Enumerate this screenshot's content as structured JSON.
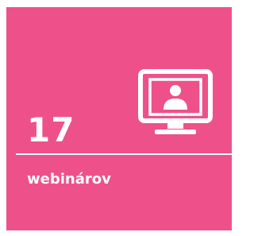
{
  "tile": {
    "background_color": "#ee5189",
    "icon": "monitor-user-icon",
    "number": "17",
    "label": "webinárov"
  }
}
